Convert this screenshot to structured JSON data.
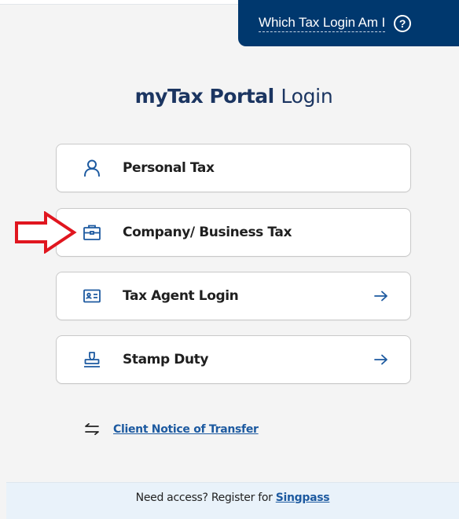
{
  "help_tab": {
    "label": "Which Tax Login Am I",
    "icon": "question-circle-icon",
    "icon_glyph": "?"
  },
  "title": {
    "strong": "myTax Portal",
    "light": "Login"
  },
  "login_options": [
    {
      "label": "Personal Tax",
      "icon": "person-icon",
      "has_arrow": false
    },
    {
      "label": "Company/ Business Tax",
      "icon": "briefcase-icon",
      "has_arrow": false
    },
    {
      "label": "Tax Agent Login",
      "icon": "id-card-icon",
      "has_arrow": true
    },
    {
      "label": "Stamp Duty",
      "icon": "stamp-icon",
      "has_arrow": true
    }
  ],
  "annotation": {
    "icon": "red-outline-arrow-icon",
    "points_to": "Company/ Business Tax"
  },
  "transfer": {
    "icon": "swap-arrows-icon",
    "link_label": "Client Notice of Transfer"
  },
  "footer": {
    "prefix": "Need access? Register for ",
    "link_label": "Singpass"
  },
  "colors": {
    "navy": "#00386e",
    "title": "#1b3561",
    "accent_blue": "#1d5aa0",
    "background": "#f4f4f4",
    "footer_bg": "#e9f2fa",
    "annotation_red": "#e0161f"
  }
}
